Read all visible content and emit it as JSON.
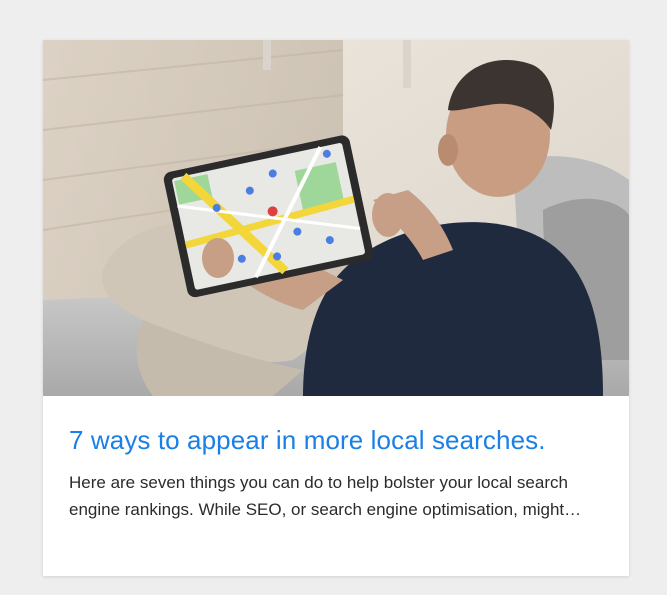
{
  "card": {
    "title": "7 ways to appear in more local searches.",
    "excerpt": "Here are seven things you can do to help bolster your local search engine rankings. While SEO, or search engine optimisation, might…"
  },
  "hero_image": {
    "icon": "photo-man-holding-tablet-with-map"
  },
  "colors": {
    "title": "#1a7fe6",
    "page_background": "#eeeeee",
    "card_background": "#ffffff"
  }
}
